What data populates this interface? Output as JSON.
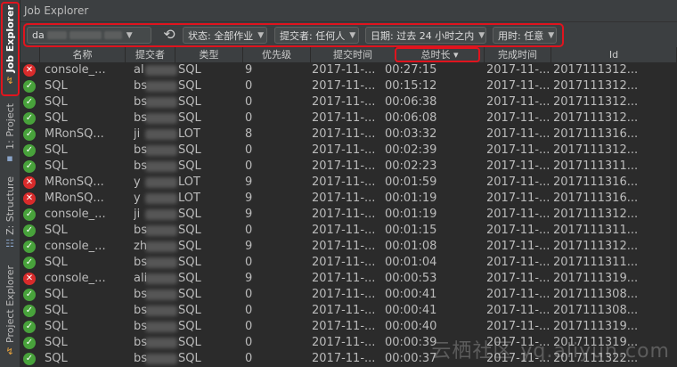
{
  "sidebar": {
    "tabs": [
      {
        "label": "Job Explorer",
        "icon": "job-explorer-icon"
      },
      {
        "label": "1: Project",
        "icon": "project-icon"
      },
      {
        "label": "Z: Structure",
        "icon": "structure-icon"
      },
      {
        "label": "Project Explorer",
        "icon": "project-explorer-icon"
      }
    ]
  },
  "window": {
    "title": "Job Explorer"
  },
  "toolbar": {
    "project_value": "da",
    "status_filter": "状态: 全部作业",
    "submitter_filter": "提交者: 任何人",
    "date_filter": "日期: 过去 24 小时之内",
    "duration_filter": "用时: 任意"
  },
  "table": {
    "headers": [
      "名称",
      "提交者",
      "类型",
      "优先级",
      "提交时间",
      "总时长 ▾",
      "完成时间",
      "Id"
    ],
    "rows": [
      {
        "status": "err",
        "name": "console_...",
        "submitter": "al",
        "type": "SQL",
        "priority": "9",
        "submit": "2017-11-...",
        "duration": "00:27:15",
        "finish": "2017-11-...",
        "id": "2017111312..."
      },
      {
        "status": "ok",
        "name": "SQL",
        "submitter": "bs",
        "type": "SQL",
        "priority": "0",
        "submit": "2017-11-...",
        "duration": "00:15:12",
        "finish": "2017-11-...",
        "id": "2017111312..."
      },
      {
        "status": "ok",
        "name": "SQL",
        "submitter": "bs",
        "type": "SQL",
        "priority": "0",
        "submit": "2017-11-...",
        "duration": "00:06:38",
        "finish": "2017-11-...",
        "id": "2017111312..."
      },
      {
        "status": "ok",
        "name": "SQL",
        "submitter": "bs",
        "type": "SQL",
        "priority": "0",
        "submit": "2017-11-...",
        "duration": "00:06:08",
        "finish": "2017-11-...",
        "id": "2017111312..."
      },
      {
        "status": "ok",
        "name": "MRonSQ...",
        "submitter": "ji",
        "type": "LOT",
        "priority": "8",
        "submit": "2017-11-...",
        "duration": "00:03:32",
        "finish": "2017-11-...",
        "id": "2017111316..."
      },
      {
        "status": "ok",
        "name": "SQL",
        "submitter": "bs",
        "type": "SQL",
        "priority": "0",
        "submit": "2017-11-...",
        "duration": "00:02:39",
        "finish": "2017-11-...",
        "id": "2017111312..."
      },
      {
        "status": "ok",
        "name": "SQL",
        "submitter": "bs",
        "type": "SQL",
        "priority": "0",
        "submit": "2017-11-...",
        "duration": "00:02:23",
        "finish": "2017-11-...",
        "id": "2017111311..."
      },
      {
        "status": "err",
        "name": "MRonSQ...",
        "submitter": "y",
        "type": "LOT",
        "priority": "9",
        "submit": "2017-11-...",
        "duration": "00:01:59",
        "finish": "2017-11-...",
        "id": "2017111316..."
      },
      {
        "status": "err",
        "name": "MRonSQ...",
        "submitter": "y",
        "type": "LOT",
        "priority": "9",
        "submit": "2017-11-...",
        "duration": "00:01:19",
        "finish": "2017-11-...",
        "id": "2017111316..."
      },
      {
        "status": "ok",
        "name": "console_...",
        "submitter": "ji",
        "type": "SQL",
        "priority": "9",
        "submit": "2017-11-...",
        "duration": "00:01:19",
        "finish": "2017-11-...",
        "id": "2017111312..."
      },
      {
        "status": "ok",
        "name": "SQL",
        "submitter": "bs",
        "type": "SQL",
        "priority": "0",
        "submit": "2017-11-...",
        "duration": "00:01:15",
        "finish": "2017-11-...",
        "id": "2017111311..."
      },
      {
        "status": "ok",
        "name": "console_...",
        "submitter": "zh",
        "type": "SQL",
        "priority": "9",
        "submit": "2017-11-...",
        "duration": "00:01:08",
        "finish": "2017-11-...",
        "id": "2017111312..."
      },
      {
        "status": "ok",
        "name": "SQL",
        "submitter": "bs",
        "type": "SQL",
        "priority": "0",
        "submit": "2017-11-...",
        "duration": "00:01:04",
        "finish": "2017-11-...",
        "id": "2017111311..."
      },
      {
        "status": "err",
        "name": "console_...",
        "submitter": "ali",
        "type": "SQL",
        "priority": "9",
        "submit": "2017-11-...",
        "duration": "00:00:53",
        "finish": "2017-11-...",
        "id": "2017111319..."
      },
      {
        "status": "ok",
        "name": "SQL",
        "submitter": "bs",
        "type": "SQL",
        "priority": "0",
        "submit": "2017-11-...",
        "duration": "00:00:41",
        "finish": "2017-11-...",
        "id": "2017111308..."
      },
      {
        "status": "ok",
        "name": "SQL",
        "submitter": "bs",
        "type": "SQL",
        "priority": "0",
        "submit": "2017-11-...",
        "duration": "00:00:41",
        "finish": "2017-11-...",
        "id": "2017111308..."
      },
      {
        "status": "ok",
        "name": "SQL",
        "submitter": "bs",
        "type": "SQL",
        "priority": "0",
        "submit": "2017-11-...",
        "duration": "00:00:40",
        "finish": "2017-11-...",
        "id": "2017111319..."
      },
      {
        "status": "ok",
        "name": "SQL",
        "submitter": "bs",
        "type": "SQL",
        "priority": "0",
        "submit": "2017-11-...",
        "duration": "00:00:39",
        "finish": "2017-11-...",
        "id": "2017111319..."
      },
      {
        "status": "ok",
        "name": "SQL",
        "submitter": "bs",
        "type": "SQL",
        "priority": "0",
        "submit": "2017-11-...",
        "duration": "00:00:37",
        "finish": "2017-11-...",
        "id": "2017111322..."
      }
    ]
  },
  "watermark": "云栖社区 yq.aliyun.com",
  "colors": {
    "ok": "#48a23b",
    "err": "#d92b2b",
    "highlight": "#e0141e"
  }
}
